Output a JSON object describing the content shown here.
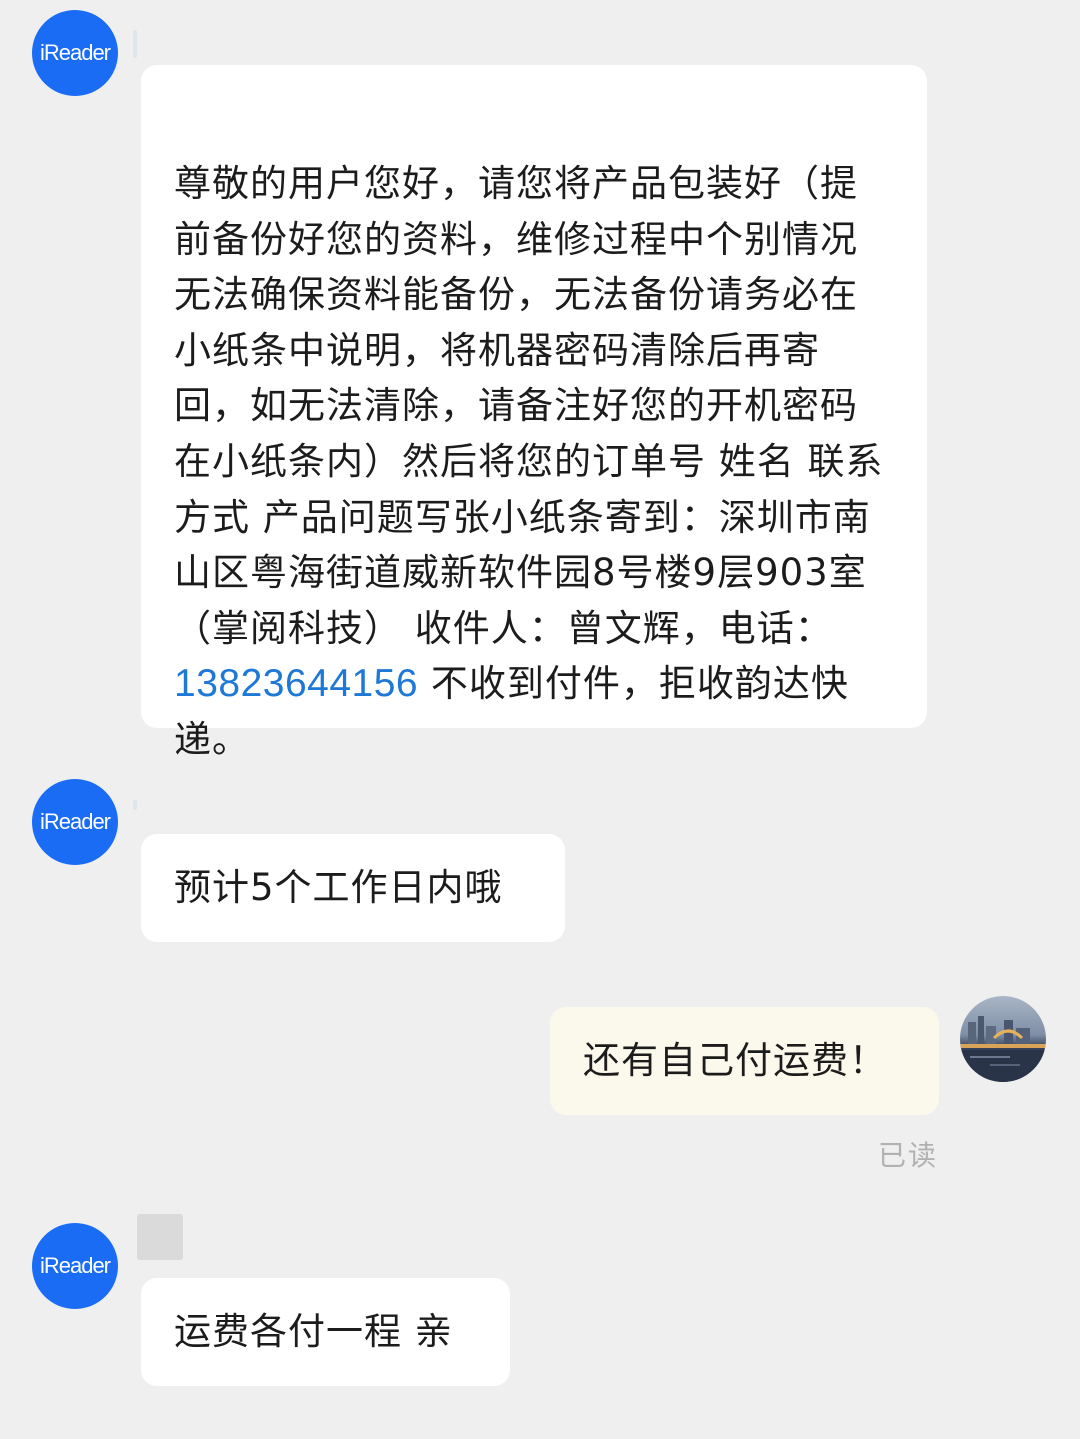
{
  "chat": {
    "contact_avatar_text": "iReader",
    "messages": [
      {
        "sender": "contact",
        "text_before_phone": "尊敬的用户您好，请您将产品包装好（提前备份好您的资料，维修过程中个别情况无法确保资料能备份，无法备份请务必在小纸条中说明，将机器密码清除后再寄回，如无法清除，请备注好您的开机密码在小纸条内）然后将您的订单号 姓名 联系方式 产品问题写张小纸条寄到：深圳市南山区粤海街道威新软件园8号楼9层903室（掌阅科技） 收件人：曾文辉，电话：",
        "phone": "13823644156",
        "text_after_phone": " 不收到付件，拒收韵达快递。"
      },
      {
        "sender": "contact",
        "text": "预计5个工作日内哦"
      },
      {
        "sender": "me",
        "text": "还有自己付运费！",
        "status": "已读"
      },
      {
        "sender": "contact",
        "text": "运费各付一程 亲"
      }
    ]
  },
  "colors": {
    "background": "#efeff0",
    "contact_bubble": "#ffffff",
    "my_bubble": "#fbf8ec",
    "avatar_blue": "#1a6cf5",
    "link_blue": "#1e78d6",
    "read_status": "#b1b1b1"
  }
}
